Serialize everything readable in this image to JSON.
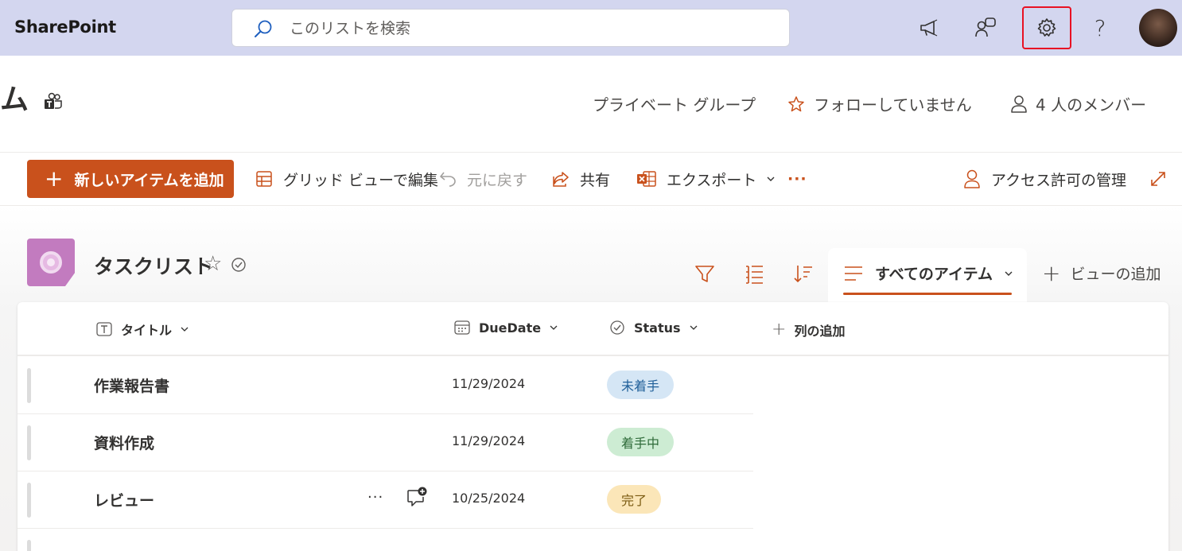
{
  "suite": {
    "app_name": "SharePoint",
    "search_placeholder": "このリストを検索",
    "icons": [
      "megaphone-icon",
      "chat-people-icon",
      "gear-icon",
      "help-icon"
    ],
    "help_glyph": "?"
  },
  "site": {
    "name_fragment": "ム",
    "privacy": "プライベート グループ",
    "follow": "フォローしていません",
    "members": "4 人のメンバー"
  },
  "commands": {
    "new_item": "新しいアイテムを追加",
    "grid_edit": "グリッド ビューで編集",
    "undo": "元に戻す",
    "share": "共有",
    "export": "エクスポート",
    "more": "···",
    "manage_access": "アクセス許可の管理"
  },
  "list": {
    "title": "タスクリスト",
    "current_view": "すべてのアイテム",
    "add_view": "ビューの追加",
    "columns": {
      "title": "タイトル",
      "due_date": "DueDate",
      "status": "Status",
      "add_column": "列の追加"
    },
    "rows": [
      {
        "title": "作業報告書",
        "due_date": "11/29/2024",
        "status": "未着手"
      },
      {
        "title": "資料作成",
        "due_date": "11/29/2024",
        "status": "着手中"
      },
      {
        "title": "レビュー",
        "due_date": "10/25/2024",
        "status": "完了"
      }
    ],
    "row_more": "···"
  },
  "colors": {
    "suite_bg": "#d3d6ef",
    "accent": "#c9511c",
    "status_not_started_bg": "#d5e6f5",
    "status_not_started_fg": "#1f5f99",
    "status_in_progress_bg": "#cdecd3",
    "status_in_progress_fg": "#2f6b3a",
    "status_done_bg": "#fbe6b8",
    "status_done_fg": "#7a5a10"
  }
}
